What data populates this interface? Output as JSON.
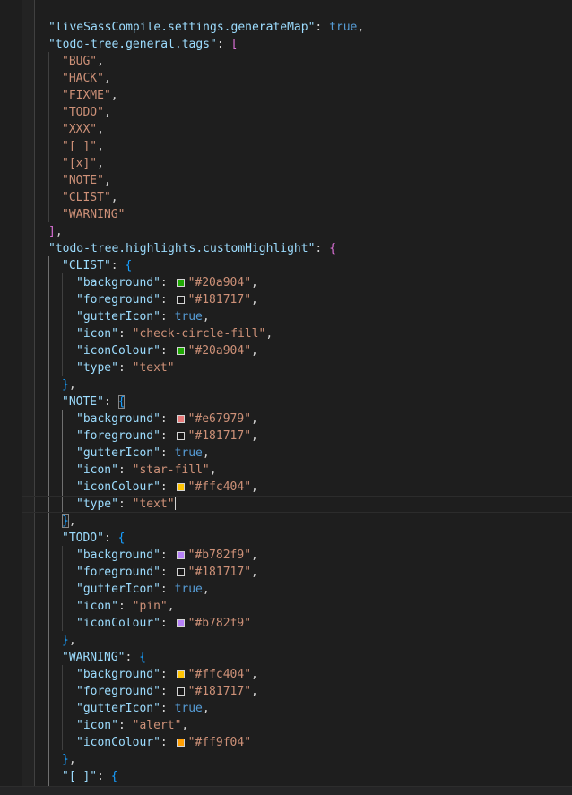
{
  "editor": {
    "lines": [
      {
        "indent": 1,
        "tokens": [
          {
            "t": "key",
            "v": "\"liveSassCompile.settings.generateMap\""
          },
          {
            "t": "punc",
            "v": ": "
          },
          {
            "t": "bool",
            "v": "true"
          },
          {
            "t": "punc",
            "v": ","
          }
        ]
      },
      {
        "indent": 1,
        "tokens": [
          {
            "t": "key",
            "v": "\"todo-tree.general.tags\""
          },
          {
            "t": "punc",
            "v": ": "
          },
          {
            "t": "bracket-p",
            "v": "["
          }
        ]
      },
      {
        "indent": 2,
        "tokens": [
          {
            "t": "str",
            "v": "\"BUG\""
          },
          {
            "t": "punc",
            "v": ","
          }
        ]
      },
      {
        "indent": 2,
        "tokens": [
          {
            "t": "str",
            "v": "\"HACK\""
          },
          {
            "t": "punc",
            "v": ","
          }
        ]
      },
      {
        "indent": 2,
        "tokens": [
          {
            "t": "str",
            "v": "\"FIXME\""
          },
          {
            "t": "punc",
            "v": ","
          }
        ]
      },
      {
        "indent": 2,
        "tokens": [
          {
            "t": "str",
            "v": "\"TODO\""
          },
          {
            "t": "punc",
            "v": ","
          }
        ]
      },
      {
        "indent": 2,
        "tokens": [
          {
            "t": "str",
            "v": "\"XXX\""
          },
          {
            "t": "punc",
            "v": ","
          }
        ]
      },
      {
        "indent": 2,
        "tokens": [
          {
            "t": "str",
            "v": "\"[ ]\""
          },
          {
            "t": "punc",
            "v": ","
          }
        ]
      },
      {
        "indent": 2,
        "tokens": [
          {
            "t": "str",
            "v": "\"[x]\""
          },
          {
            "t": "punc",
            "v": ","
          }
        ]
      },
      {
        "indent": 2,
        "tokens": [
          {
            "t": "str",
            "v": "\"NOTE\""
          },
          {
            "t": "punc",
            "v": ","
          }
        ]
      },
      {
        "indent": 2,
        "tokens": [
          {
            "t": "str",
            "v": "\"CLIST\""
          },
          {
            "t": "punc",
            "v": ","
          }
        ]
      },
      {
        "indent": 2,
        "tokens": [
          {
            "t": "str",
            "v": "\"WARNING\""
          }
        ]
      },
      {
        "indent": 1,
        "tokens": [
          {
            "t": "bracket-p",
            "v": "]"
          },
          {
            "t": "punc",
            "v": ","
          }
        ]
      },
      {
        "indent": 1,
        "tokens": [
          {
            "t": "key",
            "v": "\"todo-tree.highlights.customHighlight\""
          },
          {
            "t": "punc",
            "v": ": "
          },
          {
            "t": "bracket-p",
            "v": "{"
          }
        ]
      },
      {
        "indent": 2,
        "tokens": [
          {
            "t": "key",
            "v": "\"CLIST\""
          },
          {
            "t": "punc",
            "v": ": "
          },
          {
            "t": "bracket-b",
            "v": "{"
          }
        ]
      },
      {
        "indent": 3,
        "tokens": [
          {
            "t": "key",
            "v": "\"background\""
          },
          {
            "t": "punc",
            "v": ": "
          },
          {
            "t": "swatch",
            "v": "#20a904"
          },
          {
            "t": "str",
            "v": "\"#20a904\""
          },
          {
            "t": "punc",
            "v": ","
          }
        ]
      },
      {
        "indent": 3,
        "tokens": [
          {
            "t": "key",
            "v": "\"foreground\""
          },
          {
            "t": "punc",
            "v": ": "
          },
          {
            "t": "swatch",
            "v": "#181717"
          },
          {
            "t": "str",
            "v": "\"#181717\""
          },
          {
            "t": "punc",
            "v": ","
          }
        ]
      },
      {
        "indent": 3,
        "tokens": [
          {
            "t": "key",
            "v": "\"gutterIcon\""
          },
          {
            "t": "punc",
            "v": ": "
          },
          {
            "t": "bool",
            "v": "true"
          },
          {
            "t": "punc",
            "v": ","
          }
        ]
      },
      {
        "indent": 3,
        "tokens": [
          {
            "t": "key",
            "v": "\"icon\""
          },
          {
            "t": "punc",
            "v": ": "
          },
          {
            "t": "str",
            "v": "\"check-circle-fill\""
          },
          {
            "t": "punc",
            "v": ","
          }
        ]
      },
      {
        "indent": 3,
        "tokens": [
          {
            "t": "key",
            "v": "\"iconColour\""
          },
          {
            "t": "punc",
            "v": ": "
          },
          {
            "t": "swatch",
            "v": "#20a904"
          },
          {
            "t": "str",
            "v": "\"#20a904\""
          },
          {
            "t": "punc",
            "v": ","
          }
        ]
      },
      {
        "indent": 3,
        "tokens": [
          {
            "t": "key",
            "v": "\"type\""
          },
          {
            "t": "punc",
            "v": ": "
          },
          {
            "t": "str",
            "v": "\"text\""
          }
        ]
      },
      {
        "indent": 2,
        "tokens": [
          {
            "t": "bracket-b",
            "v": "}"
          },
          {
            "t": "punc",
            "v": ","
          }
        ]
      },
      {
        "indent": 2,
        "tokens": [
          {
            "t": "key",
            "v": "\"NOTE\""
          },
          {
            "t": "punc",
            "v": ": "
          },
          {
            "t": "bracket-b-box",
            "v": "{"
          }
        ]
      },
      {
        "indent": 3,
        "tokens": [
          {
            "t": "key",
            "v": "\"background\""
          },
          {
            "t": "punc",
            "v": ": "
          },
          {
            "t": "swatch",
            "v": "#e67979"
          },
          {
            "t": "str",
            "v": "\"#e67979\""
          },
          {
            "t": "punc",
            "v": ","
          }
        ]
      },
      {
        "indent": 3,
        "tokens": [
          {
            "t": "key",
            "v": "\"foreground\""
          },
          {
            "t": "punc",
            "v": ": "
          },
          {
            "t": "swatch",
            "v": "#181717"
          },
          {
            "t": "str",
            "v": "\"#181717\""
          },
          {
            "t": "punc",
            "v": ","
          }
        ]
      },
      {
        "indent": 3,
        "tokens": [
          {
            "t": "key",
            "v": "\"gutterIcon\""
          },
          {
            "t": "punc",
            "v": ": "
          },
          {
            "t": "bool",
            "v": "true"
          },
          {
            "t": "punc",
            "v": ","
          }
        ]
      },
      {
        "indent": 3,
        "tokens": [
          {
            "t": "key",
            "v": "\"icon\""
          },
          {
            "t": "punc",
            "v": ": "
          },
          {
            "t": "str",
            "v": "\"star-fill\""
          },
          {
            "t": "punc",
            "v": ","
          }
        ]
      },
      {
        "indent": 3,
        "tokens": [
          {
            "t": "key",
            "v": "\"iconColour\""
          },
          {
            "t": "punc",
            "v": ": "
          },
          {
            "t": "swatch",
            "v": "#ffc404"
          },
          {
            "t": "str",
            "v": "\"#ffc404\""
          },
          {
            "t": "punc",
            "v": ","
          }
        ]
      },
      {
        "indent": 3,
        "current": true,
        "tokens": [
          {
            "t": "key",
            "v": "\"type\""
          },
          {
            "t": "punc",
            "v": ": "
          },
          {
            "t": "str",
            "v": "\"text\""
          },
          {
            "t": "cursor",
            "v": ""
          }
        ]
      },
      {
        "indent": 2,
        "tokens": [
          {
            "t": "bracket-b-box",
            "v": "}"
          },
          {
            "t": "punc",
            "v": ","
          }
        ]
      },
      {
        "indent": 2,
        "tokens": [
          {
            "t": "key",
            "v": "\"TODO\""
          },
          {
            "t": "punc",
            "v": ": "
          },
          {
            "t": "bracket-b",
            "v": "{"
          }
        ]
      },
      {
        "indent": 3,
        "tokens": [
          {
            "t": "key",
            "v": "\"background\""
          },
          {
            "t": "punc",
            "v": ": "
          },
          {
            "t": "swatch",
            "v": "#b782f9"
          },
          {
            "t": "str",
            "v": "\"#b782f9\""
          },
          {
            "t": "punc",
            "v": ","
          }
        ]
      },
      {
        "indent": 3,
        "tokens": [
          {
            "t": "key",
            "v": "\"foreground\""
          },
          {
            "t": "punc",
            "v": ": "
          },
          {
            "t": "swatch",
            "v": "#181717"
          },
          {
            "t": "str",
            "v": "\"#181717\""
          },
          {
            "t": "punc",
            "v": ","
          }
        ]
      },
      {
        "indent": 3,
        "tokens": [
          {
            "t": "key",
            "v": "\"gutterIcon\""
          },
          {
            "t": "punc",
            "v": ": "
          },
          {
            "t": "bool",
            "v": "true"
          },
          {
            "t": "punc",
            "v": ","
          }
        ]
      },
      {
        "indent": 3,
        "tokens": [
          {
            "t": "key",
            "v": "\"icon\""
          },
          {
            "t": "punc",
            "v": ": "
          },
          {
            "t": "str",
            "v": "\"pin\""
          },
          {
            "t": "punc",
            "v": ","
          }
        ]
      },
      {
        "indent": 3,
        "tokens": [
          {
            "t": "key",
            "v": "\"iconColour\""
          },
          {
            "t": "punc",
            "v": ": "
          },
          {
            "t": "swatch",
            "v": "#b782f9"
          },
          {
            "t": "str",
            "v": "\"#b782f9\""
          }
        ]
      },
      {
        "indent": 2,
        "tokens": [
          {
            "t": "bracket-b",
            "v": "}"
          },
          {
            "t": "punc",
            "v": ","
          }
        ]
      },
      {
        "indent": 2,
        "tokens": [
          {
            "t": "key",
            "v": "\"WARNING\""
          },
          {
            "t": "punc",
            "v": ": "
          },
          {
            "t": "bracket-b",
            "v": "{"
          }
        ]
      },
      {
        "indent": 3,
        "tokens": [
          {
            "t": "key",
            "v": "\"background\""
          },
          {
            "t": "punc",
            "v": ": "
          },
          {
            "t": "swatch",
            "v": "#ffc404"
          },
          {
            "t": "str",
            "v": "\"#ffc404\""
          },
          {
            "t": "punc",
            "v": ","
          }
        ]
      },
      {
        "indent": 3,
        "tokens": [
          {
            "t": "key",
            "v": "\"foreground\""
          },
          {
            "t": "punc",
            "v": ": "
          },
          {
            "t": "swatch",
            "v": "#181717"
          },
          {
            "t": "str",
            "v": "\"#181717\""
          },
          {
            "t": "punc",
            "v": ","
          }
        ]
      },
      {
        "indent": 3,
        "tokens": [
          {
            "t": "key",
            "v": "\"gutterIcon\""
          },
          {
            "t": "punc",
            "v": ": "
          },
          {
            "t": "bool",
            "v": "true"
          },
          {
            "t": "punc",
            "v": ","
          }
        ]
      },
      {
        "indent": 3,
        "tokens": [
          {
            "t": "key",
            "v": "\"icon\""
          },
          {
            "t": "punc",
            "v": ": "
          },
          {
            "t": "str",
            "v": "\"alert\""
          },
          {
            "t": "punc",
            "v": ","
          }
        ]
      },
      {
        "indent": 3,
        "tokens": [
          {
            "t": "key",
            "v": "\"iconColour\""
          },
          {
            "t": "punc",
            "v": ": "
          },
          {
            "t": "swatch",
            "v": "#ff9f04"
          },
          {
            "t": "str",
            "v": "\"#ff9f04\""
          }
        ]
      },
      {
        "indent": 2,
        "tokens": [
          {
            "t": "bracket-b",
            "v": "}"
          },
          {
            "t": "punc",
            "v": ","
          }
        ]
      },
      {
        "indent": 2,
        "tokens": [
          {
            "t": "key",
            "v": "\"[ ]\""
          },
          {
            "t": "punc",
            "v": ": "
          },
          {
            "t": "bracket-b",
            "v": "{"
          }
        ]
      }
    ]
  },
  "colors": {
    "background": "#1e1e1e",
    "key": "#9cdcfe",
    "string": "#ce9178",
    "boolean": "#569cd6",
    "bracket_pink": "#da70d6",
    "bracket_blue": "#179fff"
  }
}
